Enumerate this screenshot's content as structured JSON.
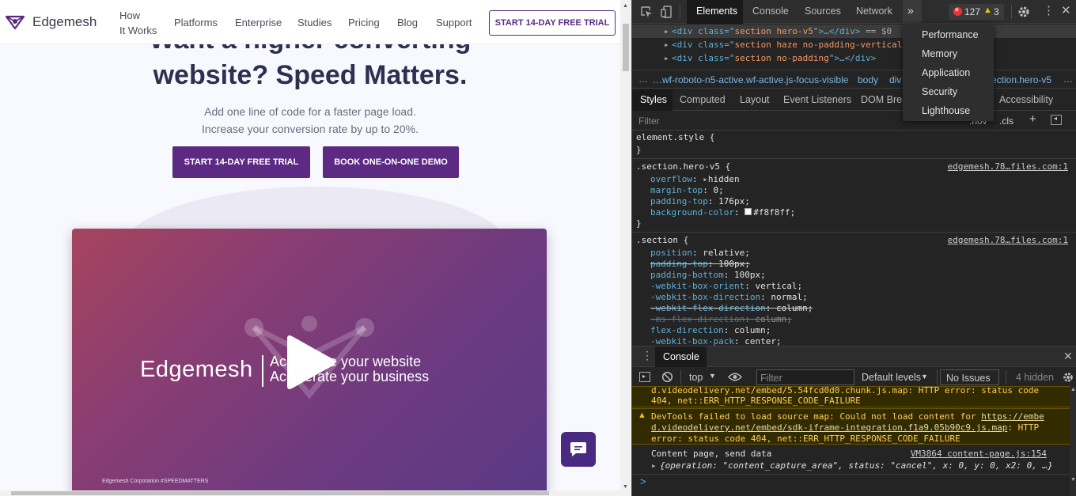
{
  "site": {
    "logo_text": "Edgemesh",
    "nav": [
      "How",
      "It Works",
      "Platforms",
      "Enterprise",
      "Studies",
      "Pricing",
      "Blog",
      "Support"
    ],
    "nav_cta": "START 14-DAY FREE TRIAL",
    "hero_title_1": "Want a higher converting",
    "hero_title_2": "website? Speed Matters.",
    "hero_sub_1": "Add one line of code for a faster page load.",
    "hero_sub_2": "Increase your conversion rate by up to 20%.",
    "btn_trial": "START 14-DAY FREE TRIAL",
    "btn_demo": "BOOK ONE-ON-ONE DEMO",
    "video_brand": "Edgemesh",
    "video_tag_1": "Accelerate your website",
    "video_tag_2": "Accelerate your business",
    "video_footer": "Edgemesh Corporation #SPEEDMATTERS"
  },
  "devtools": {
    "tabs": [
      "Elements",
      "Console",
      "Sources",
      "Network"
    ],
    "error_count": "127",
    "warn_count": "3",
    "overflow_menu": [
      "Performance",
      "Memory",
      "Application",
      "Security",
      "Lighthouse"
    ],
    "dom_lines": [
      {
        "pre": "<div class=\"",
        "cls": "section hero-v5",
        "post": "\">…</div>",
        "suffix": " == $0"
      },
      {
        "pre": "<div class=\"",
        "cls": "section haze no-padding-vertical",
        "post": "",
        "suffix": ""
      },
      {
        "pre": "<div class=\"",
        "cls": "section no-padding",
        "post": "\">…</div>",
        "suffix": ""
      }
    ],
    "breadcrumb": [
      "…wf-roboto-n5-active.wf-active.js-focus-visible",
      "body",
      "div",
      "section.hero-v5"
    ],
    "style_tabs": [
      "Styles",
      "Computed",
      "Layout",
      "Event Listeners",
      "DOM Brea…",
      "s",
      "Accessibility"
    ],
    "filter_placeholder": "Filter",
    "hov_label": ":hov",
    "cls_label": ".cls",
    "rules": {
      "element_style": "element.style {",
      "hero_selector": ".section.hero-v5 {",
      "hero_source": "edgemesh.78…files.com:1",
      "hero_props": [
        {
          "p": "overflow",
          "v": "hidden",
          "arrow": true
        },
        {
          "p": "margin-top",
          "v": "0;"
        },
        {
          "p": "padding-top",
          "v": "176px;"
        },
        {
          "p": "background-color",
          "v": "#f8f8ff;",
          "swatch": "#f8f8ff"
        }
      ],
      "section_selector": ".section {",
      "section_source": "edgemesh.78…files.com:1",
      "section_props": [
        {
          "p": "position",
          "v": "relative;"
        },
        {
          "p": "padding-top",
          "v": "100px;",
          "strike": true
        },
        {
          "p": "padding-bottom",
          "v": "100px;"
        },
        {
          "p": "-webkit-box-orient",
          "v": "vertical;"
        },
        {
          "p": "-webkit-box-direction",
          "v": "normal;"
        },
        {
          "p": "-webkit-flex-direction",
          "v": "column;",
          "strike": true
        },
        {
          "p": "-ms-flex-direction",
          "v": "column;",
          "strike": true,
          "dim": true
        },
        {
          "p": "flex-direction",
          "v": "column;"
        },
        {
          "p": "-webkit-box-pack",
          "v": "center;"
        }
      ]
    },
    "console": {
      "tab": "Console",
      "context": "top",
      "filter_placeholder": "Filter",
      "levels": "Default levels",
      "issues": "No Issues",
      "hidden": "4 hidden",
      "msg1_line1": "d.videodelivery.net/embed/5.54fcd0d0.chunk.js.map: HTTP error: status code",
      "msg1_line2": "404, net::ERR_HTTP_RESPONSE_CODE_FAILURE",
      "msg2_lead": "DevTools failed to load source map: Could not load content for ",
      "msg2_link1": "https://embe",
      "msg2_link2": "d.videodelivery.net/embed/sdk-iframe-integration.f1a9.05b90c9.js.map",
      "msg2_tail": ": HTTP",
      "msg2_line3": "error: status code 404, net::ERR_HTTP_RESPONSE_CODE_FAILURE",
      "msg3_text": "Content page, send data",
      "msg3_source": "VM3864 content-page.js:154",
      "msg3_obj": "{operation: \"content_capture_area\", status: \"cancel\", x: 0, y: 0, x2: 0, …}",
      "prompt": ">"
    }
  }
}
